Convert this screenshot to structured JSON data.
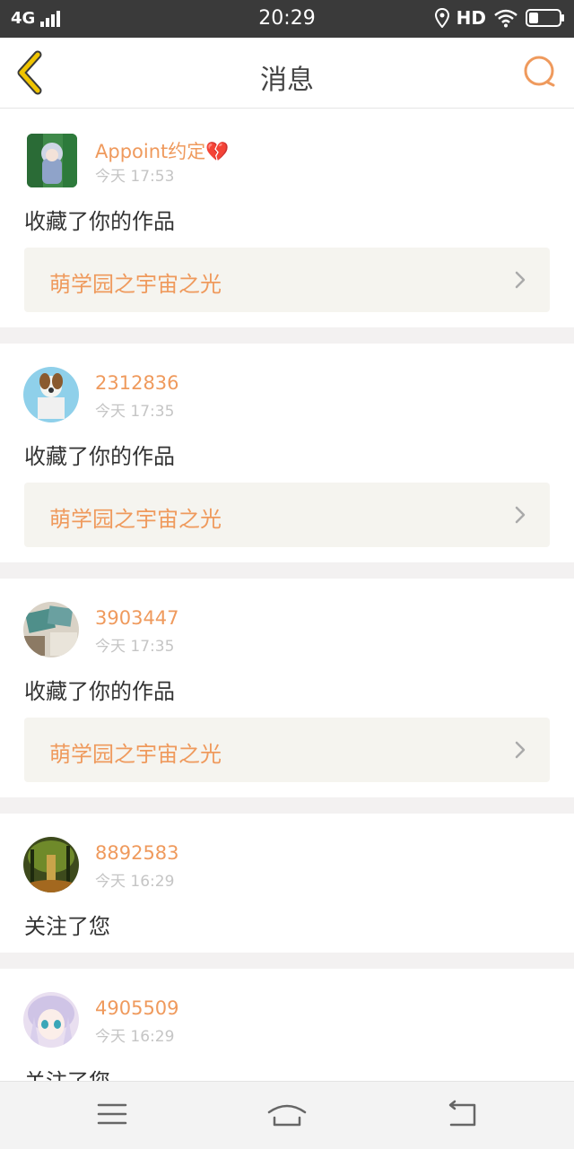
{
  "status_bar": {
    "network": "4G",
    "time": "20:29",
    "hd_label": "HD"
  },
  "header": {
    "title": "消息"
  },
  "notifications": [
    {
      "username": "Appoint约定",
      "emoji": "💔",
      "time": "今天 17:53",
      "action": "收藏了你的作品",
      "work_title": "萌学园之宇宙之光"
    },
    {
      "username": "2312836",
      "time": "今天 17:35",
      "action": "收藏了你的作品",
      "work_title": "萌学园之宇宙之光"
    },
    {
      "username": "3903447",
      "time": "今天 17:35",
      "action": "收藏了你的作品",
      "work_title": "萌学园之宇宙之光"
    },
    {
      "username": "8892583",
      "time": "今天 16:29",
      "action": "关注了您"
    },
    {
      "username": "4905509",
      "time": "今天 16:29",
      "action": "关注了您"
    }
  ],
  "colors": {
    "accent": "#ef9a5d",
    "back_arrow": "#f0c400",
    "status_bar": "#3a3a3a"
  }
}
